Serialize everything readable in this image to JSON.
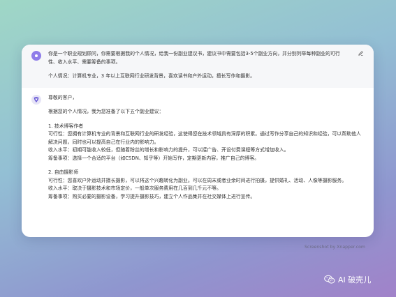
{
  "user": {
    "prompt": "你是一个职业规划顾问，你需要根据我的个人情况，给我一份副业建议书，建议书中需要包括3-5个副业方向，并分别列举每种副业的可行性、收入水平、需要筹备的事项。",
    "personal_info": "个人情况：计算机专业，3 年以上互联网行业研发背景，喜欢读书和户外运动，擅长写作和摄影。"
  },
  "assistant": {
    "greeting": "尊敬的客户，",
    "intro": "根据您的个人情况，我为您准备了以下五个副业建议：",
    "items": [
      {
        "title": "1. 技术博客作者",
        "feasibility": "可行性：您拥有计算机专业的背景和互联网行业的研发经验，这使得您在技术领域具有深厚的积累。通过写作分享自己的知识和经验，可以帮助他人解决问题，同时也可以提高自己在行业内的影响力。",
        "income": "收入水平：初期可能收入较低，但随着粉丝的增长和影响力的提升，可以接广告、开设付费课程等方式增加收入。",
        "prep": "筹备事项：选择一个合适的平台（如CSDN、知乎等）开始写作，定期更新内容，推广自己的博客。"
      },
      {
        "title": "2. 自由摄影师",
        "feasibility": "可行性：您喜欢户外运动并擅长摄影，可以将这个兴趣转化为副业。可以在周末或者业余时间进行拍摄，提供婚礼、活动、人像等摄影服务。",
        "income": "收入水平：取决于摄影技术和市场定价，一般单次服务费用在几百到几千元不等。",
        "prep": "筹备事项：购买必要的摄影设备，学习提升摄影技巧，建立个人作品集并在社交媒体上进行宣传。"
      }
    ]
  },
  "watermark": "Screenshot by Xnapper.com",
  "brand": "AI 破壳儿",
  "icons": {
    "user_avatar": "user-avatar-icon",
    "assistant_avatar": "assistant-logo-icon",
    "edit": "edit-pencil-icon",
    "brand": "wechat-icon"
  },
  "colors": {
    "user_avatar": "#8e7de9",
    "user_bg": "#f6f7f9"
  }
}
